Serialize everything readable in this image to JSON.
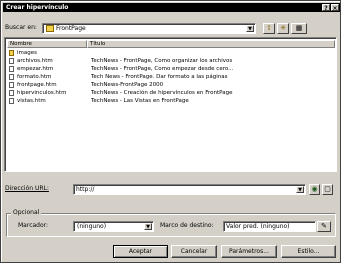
{
  "window": {
    "title": "Crear hipervínculo",
    "help_btn": "?",
    "close_btn": "×"
  },
  "lookin": {
    "label": "Buscar en:",
    "value": "FrontPage"
  },
  "toolbar": {
    "up": "⇧",
    "newfolder": "✳",
    "views": "▦"
  },
  "columns": {
    "name": "Nombre",
    "title": "Título"
  },
  "files": [
    {
      "name": "images",
      "title": "",
      "type": "folder"
    },
    {
      "name": "archivos.htm",
      "title": "TechNews - FrontPage, Como organizar los archivos",
      "type": "file"
    },
    {
      "name": "empezar.htm",
      "title": "TechNews - FrontPage, Como empezar desde cero...",
      "type": "file"
    },
    {
      "name": "formato.htm",
      "title": "Tech News - FrontPage. Dar formato a las páginas",
      "type": "file"
    },
    {
      "name": "frontpage.htm",
      "title": "TechNews-FrontPage 2000",
      "type": "file"
    },
    {
      "name": "hipervinculos.htm",
      "title": "TechNews - Creación de hipervínculos en FrontPage",
      "type": "file"
    },
    {
      "name": "vistas.htm",
      "title": "TechNews - Las Vistas en FrontPage",
      "type": "file"
    }
  ],
  "url": {
    "label": "Dirección URL:",
    "value": "http://"
  },
  "optional": {
    "group_label": "Opcional",
    "bookmark_label": "Marcador:",
    "bookmark_value": "(ninguno)",
    "target_label": "Marco de destino:",
    "target_value": "Valor pred. (ninguno)"
  },
  "buttons": {
    "ok": "Aceptar",
    "cancel": "Cancelar",
    "params": "Parámetros...",
    "style": "Estilo..."
  }
}
